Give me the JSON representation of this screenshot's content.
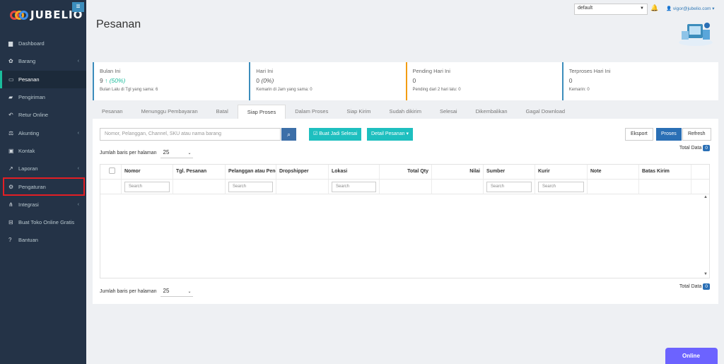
{
  "brand": {
    "name": "JUBELIO"
  },
  "sidebar": {
    "items": [
      {
        "label": "Dashboard",
        "icon": "dashboard-icon",
        "glyph": "▆",
        "chevron": false
      },
      {
        "label": "Barang",
        "icon": "cubes-icon",
        "glyph": "✿",
        "chevron": true
      },
      {
        "label": "Pesanan",
        "icon": "cart-icon",
        "glyph": "▭",
        "chevron": false,
        "active": true
      },
      {
        "label": "Pengiriman",
        "icon": "truck-icon",
        "glyph": "▰",
        "chevron": false
      },
      {
        "label": "Retur Online",
        "icon": "return-icon",
        "glyph": "↶",
        "chevron": false
      },
      {
        "label": "Akunting",
        "icon": "balance-icon",
        "glyph": "⚖",
        "chevron": true
      },
      {
        "label": "Kontak",
        "icon": "contact-card-icon",
        "glyph": "▣",
        "chevron": false
      },
      {
        "label": "Laporan",
        "icon": "chart-icon",
        "glyph": "↗",
        "chevron": true
      },
      {
        "label": "Pengaturan",
        "icon": "gears-icon",
        "glyph": "⚙",
        "chevron": false,
        "highlight": true
      },
      {
        "label": "Integrasi",
        "icon": "sitemap-icon",
        "glyph": "⋔",
        "chevron": true
      },
      {
        "label": "Buat Toko Online Gratis",
        "icon": "shopping-cart-icon",
        "glyph": "⊟",
        "chevron": false
      },
      {
        "label": "Bantuan",
        "icon": "question-icon",
        "glyph": "?",
        "chevron": false
      }
    ]
  },
  "header": {
    "title": "Pesanan",
    "location_select": "default",
    "user_email": "vigor@jubelio.com"
  },
  "stats": [
    {
      "label": "Bulan Ini",
      "value": "9",
      "trend": "(50%)",
      "trend_up": true,
      "sub": "Bulan Lalu di Tgl yang sama: 6",
      "color": "#3c8dbc"
    },
    {
      "label": "Hari Ini",
      "value": "0",
      "trend": "(0%)",
      "trend_up": false,
      "sub": "Kemarin di Jam yang sama: 0",
      "color": "#3c8dbc"
    },
    {
      "label": "Pending Hari Ini",
      "value": "0",
      "trend": "",
      "trend_up": false,
      "sub": "Pending dari 2 hari lalu: 0",
      "color": "#f39c12"
    },
    {
      "label": "Terproses Hari Ini",
      "value": "0",
      "trend": "",
      "trend_up": false,
      "sub": "Kemarin: 0",
      "color": "#3c8dbc"
    }
  ],
  "tabs": [
    {
      "label": "Pesanan"
    },
    {
      "label": "Menunggu Pembayaran"
    },
    {
      "label": "Batal"
    },
    {
      "label": "Siap Proses",
      "active": true
    },
    {
      "label": "Dalam Proses"
    },
    {
      "label": "Siap Kirim"
    },
    {
      "label": "Sudah dikirim"
    },
    {
      "label": "Selesai"
    },
    {
      "label": "Dikembalikan"
    },
    {
      "label": "Gagal Download"
    }
  ],
  "toolbar": {
    "search_placeholder": "Nomor, Pelanggan, Channel, SKU atau nama barang",
    "done_button": "Buat Jadi Selesai",
    "detail_button": "Detail Pesanan",
    "export_button": "Eksport",
    "process_button": "Proses",
    "refresh_button": "Refresh"
  },
  "pagination": {
    "rows_label": "Jumlah baris per halaman",
    "rows_value": "25",
    "total_label": "Total Data",
    "total_value": "0"
  },
  "grid": {
    "columns": [
      {
        "label": "",
        "width": 30,
        "checkbox": true,
        "filter": false
      },
      {
        "label": "Nomor",
        "width": 73,
        "filter": true
      },
      {
        "label": "Tgl. Pesanan",
        "width": 74,
        "filter": false
      },
      {
        "label": "Pelanggan atau Pengirim",
        "width": 72,
        "filter": true
      },
      {
        "label": "Dropshipper",
        "width": 74,
        "filter": false
      },
      {
        "label": "Lokasi",
        "width": 72,
        "filter": true
      },
      {
        "label": "Total Qty",
        "width": 74,
        "filter": false,
        "align": "right"
      },
      {
        "label": "Nilai",
        "width": 73,
        "filter": false,
        "align": "right"
      },
      {
        "label": "Sumber",
        "width": 73,
        "filter": true
      },
      {
        "label": "Kurir",
        "width": 74,
        "filter": true
      },
      {
        "label": "Note",
        "width": 73,
        "filter": false
      },
      {
        "label": "Batas Kirim",
        "width": 74,
        "filter": false
      }
    ],
    "filter_placeholder": "Search"
  },
  "chat": {
    "label": "Online"
  },
  "colors": {
    "sidebar": "#243347",
    "accent": "#1abc9c",
    "primary": "#2a6fb5",
    "teal": "#1ebfbf",
    "highlight": "#e31e24",
    "chat": "#6c63ff"
  }
}
